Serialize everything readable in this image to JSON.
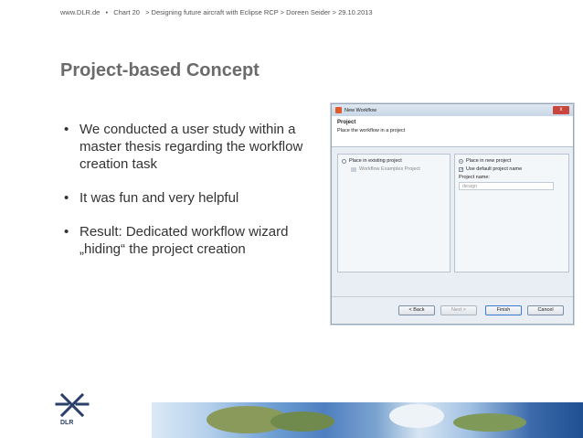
{
  "header": {
    "site": "www.DLR.de",
    "sep": "•",
    "chart": "Chart 20",
    "breadcrumb": "> Designing future aircraft with Eclipse RCP > Doreen Seider > 29.10.2013"
  },
  "slide": {
    "title": "Project-based Concept",
    "bullets": [
      "We conducted a user study within a master thesis regarding the workflow creation task",
      "It was fun and very helpful",
      "Result: Dedicated workflow wizard „hiding“ the project creation"
    ],
    "bullet_glyph": "•"
  },
  "dialog": {
    "window_title": "New Workflow",
    "close_label": "x",
    "banner_title": "Project",
    "banner_desc": "Place the workflow in a project",
    "left": {
      "radio_label": "Place in existing project",
      "tree_item": "Workflow Examples Project"
    },
    "right": {
      "radio_label": "Place in new project",
      "check_label": "Use default project name",
      "field_label": "Project name:",
      "field_value": "design"
    },
    "buttons": {
      "back": "< Back",
      "next": "Next >",
      "finish": "Finish",
      "cancel": "Cancel"
    }
  },
  "footer": {
    "logo_text": "DLR"
  },
  "colors": {
    "title": "#6b6b6b",
    "dlr_blue": "#2a3f6a"
  }
}
